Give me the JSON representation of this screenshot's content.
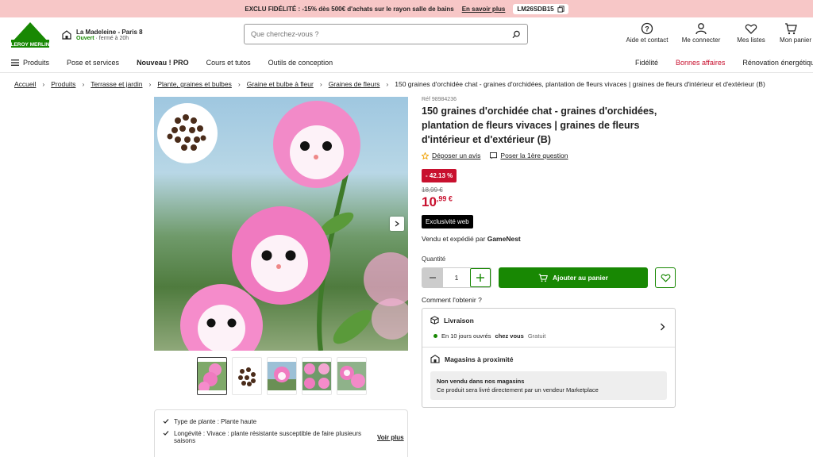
{
  "promo": {
    "text": "EXCLU FIDÉLITÉ : -15% dès 500€ d'achats sur le rayon salle de bains",
    "link": "En savoir plus",
    "code": "LM26SDB15"
  },
  "header": {
    "logo_text": "LEROY MERLIN",
    "store_name": "La Madeleine - Paris 8",
    "store_status": "Ouvert",
    "store_hours": " · fermé à 20h",
    "search_placeholder": "Que cherchez-vous ?",
    "icons": [
      {
        "label": "Aide et contact",
        "icon": "help-icon"
      },
      {
        "label": "Me connecter",
        "icon": "user-icon"
      },
      {
        "label": "Mes listes",
        "icon": "heart-icon"
      },
      {
        "label": "Mon panier",
        "icon": "cart-icon"
      }
    ]
  },
  "nav": {
    "products": "Produits",
    "items": [
      "Pose et services",
      "Nouveau ! PRO",
      "Cours et tutos",
      "Outils de conception"
    ],
    "right": [
      "Fidélité",
      "Bonnes affaires",
      "Rénovation énergétique"
    ]
  },
  "breadcrumb": [
    "Accueil",
    "Produits",
    "Terrasse et jardin",
    "Plante, graines et bulbes",
    "Graine et bulbe à fleur",
    "Graines de fleurs"
  ],
  "breadcrumb_current": "150 graines d'orchidée chat - graines d'orchidées, plantation de fleurs vivaces | graines de fleurs d'intérieur et d'extérieur (B)",
  "product": {
    "ref": "Réf 98984236",
    "title": "150 graines d'orchidée chat - graines d'orchidées, plantation de fleurs vivaces | graines de fleurs d'intérieur et d'extérieur (B)",
    "review_link": "Déposer un avis",
    "question_link": "Poser la 1ère question",
    "discount": "- 42.13 %",
    "old_price": "18,99 €",
    "price_main": "10",
    "price_cents": ",99 €",
    "web_badge": "Exclusivité web",
    "seller_prefix": "Vendu et expédié par ",
    "seller_name": "GameNest",
    "qty_label": "Quantité",
    "qty_value": "1",
    "add_cart": "Ajouter au panier",
    "how_label": "Comment l'obtenir ?",
    "delivery_title": "Livraison",
    "delivery_text_pre": "En 10 jours ouvrés ",
    "delivery_text_bold": "chez vous",
    "delivery_free": " Gratuit",
    "stores_title": "Magasins à proximité",
    "stores_notice_title": "Non vendu dans nos magasins",
    "stores_notice_text": "Ce produit sera livré directement par un vendeur Marketplace"
  },
  "features": [
    {
      "label": "Type de plante : Plante haute"
    },
    {
      "label": "Longévité : Vivace : plante résistante susceptible de faire plusieurs saisons"
    }
  ],
  "features_more": "Voir plus",
  "colors": {
    "green": "#188803",
    "red": "#c8102e",
    "promo_bg": "#f7c7c7"
  }
}
